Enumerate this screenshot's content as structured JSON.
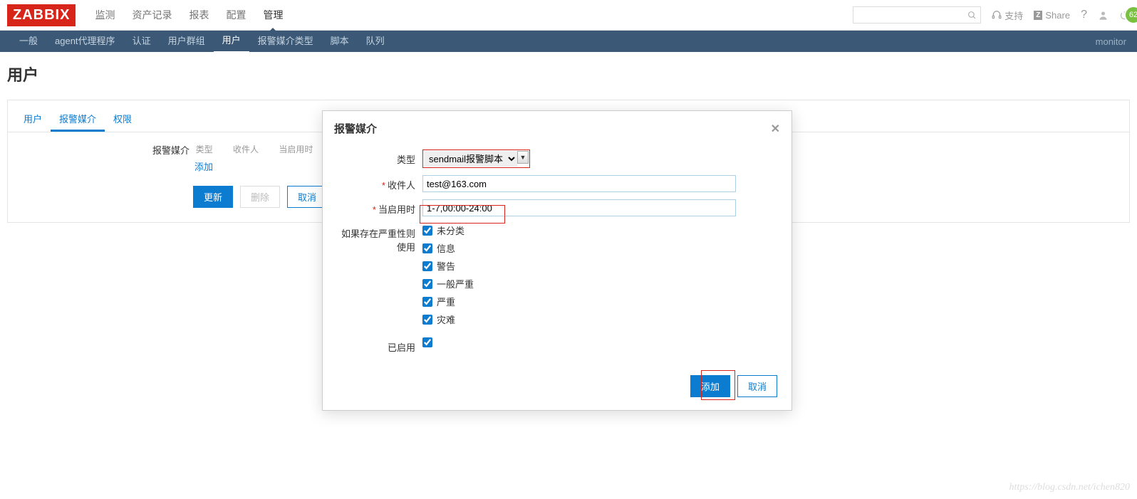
{
  "logo": "ZABBIX",
  "main_nav": {
    "items": [
      "监测",
      "资产记录",
      "报表",
      "配置",
      "管理"
    ],
    "active": 4
  },
  "top_right": {
    "support": "支持",
    "share": "Share",
    "badge": "62"
  },
  "sub_nav": {
    "items": [
      "一般",
      "agent代理程序",
      "认证",
      "用户群组",
      "用户",
      "报警媒介类型",
      "脚本",
      "队列"
    ],
    "active": 4,
    "right": "monitor"
  },
  "page_title": "用户",
  "tabs": {
    "items": [
      "用户",
      "报警媒介",
      "权限"
    ],
    "active": 1
  },
  "media_section": {
    "label": "报警媒介",
    "headers": {
      "type": "类型",
      "recipient": "收件人",
      "when": "当启用时"
    },
    "add_link": "添加"
  },
  "buttons": {
    "update": "更新",
    "delete": "删除",
    "cancel": "取消"
  },
  "modal": {
    "title": "报警媒介",
    "labels": {
      "type": "类型",
      "recipient": "收件人",
      "when": "当启用时",
      "severity": "如果存在严重性则使用",
      "enabled": "已启用"
    },
    "type_value": "sendmail报警脚本",
    "recipient_value": "test@163.com",
    "when_value": "1-7,00:00-24:00",
    "severities": [
      "未分类",
      "信息",
      "警告",
      "一般严重",
      "严重",
      "灾难"
    ],
    "add": "添加",
    "cancel": "取消"
  },
  "watermark": "https://blog.csdn.net/ichen820"
}
